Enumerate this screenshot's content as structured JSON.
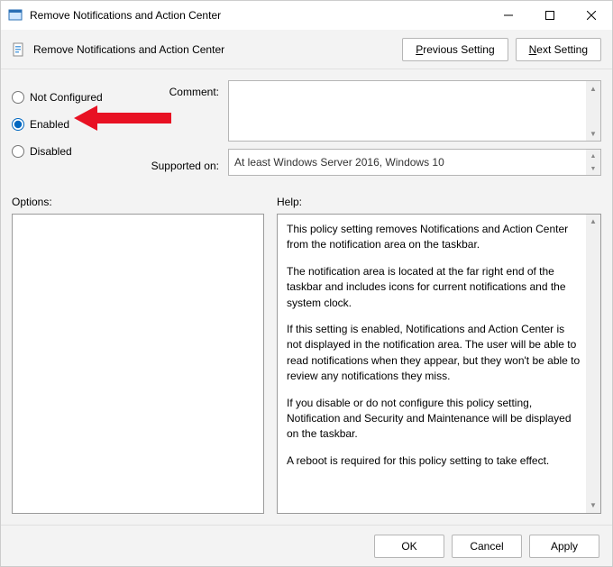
{
  "window": {
    "title": "Remove Notifications and Action Center"
  },
  "subheader": {
    "title": "Remove Notifications and Action Center",
    "prev": "Previous Setting",
    "prev_ul": "P",
    "prev_rest": "revious Setting",
    "next": "Next Setting",
    "next_ul": "N",
    "next_rest": "ext Setting"
  },
  "config": {
    "not_configured": "Not Configured",
    "enabled": "Enabled",
    "disabled": "Disabled",
    "comment_label": "Comment:",
    "comment_value": "",
    "supported_label": "Supported on:",
    "supported_value": "At least Windows Server 2016, Windows 10"
  },
  "lower": {
    "options_label": "Options:",
    "help_label": "Help:",
    "help_p1": "This policy setting removes Notifications and Action Center from the notification area on the taskbar.",
    "help_p2": "The notification area is located at the far right end of the taskbar and includes icons for current notifications and the system clock.",
    "help_p3": "If this setting is enabled, Notifications and Action Center is not displayed in the notification area. The user will be able to read notifications when they appear, but they won't be able to review any notifications they miss.",
    "help_p4": "If you disable or do not configure this policy setting, Notification and Security and Maintenance will be displayed on the taskbar.",
    "help_p5": "A reboot is required for this policy setting to take effect."
  },
  "footer": {
    "ok": "OK",
    "cancel": "Cancel",
    "apply": "Apply"
  }
}
